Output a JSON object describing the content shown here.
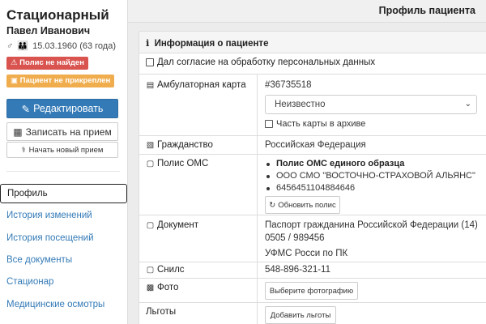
{
  "patient": {
    "last_name": "Стационарный",
    "first_names": "Павел Иванович",
    "dob": "15.03.1960 (63 года)",
    "badges": {
      "not_found": "Полис не найден",
      "not_attached": "Пациент не прикреплен"
    }
  },
  "actions": {
    "edit": "Редактировать",
    "appoint": "Записать на прием",
    "new_visit": "Начать новый прием"
  },
  "nav": {
    "items": [
      {
        "label": "Профиль",
        "active": true
      },
      {
        "label": "История изменений"
      },
      {
        "label": "История посещений"
      },
      {
        "label": "Все документы"
      },
      {
        "label": "Стационар"
      },
      {
        "label": "Медицинские осмотры"
      }
    ]
  },
  "header": {
    "title": "Профиль пациента"
  },
  "panel": {
    "title": "Информация о пациенте",
    "consent": "Дал согласие на обработку персональных данных",
    "outpatient_card": {
      "label": "Амбулаторная карта",
      "number": "#36735518",
      "select_value": "Неизвестно",
      "archive_label": "Часть карты в архиве"
    },
    "citizenship": {
      "label": "Гражданство",
      "value": "Российская Федерация"
    },
    "oms": {
      "label": "Полис ОМС",
      "items": [
        "Полис ОМС единого образца",
        "ООО СМО \"ВОСТОЧНО-СТРАХОВОЙ АЛЬЯНС\"",
        "6456451104884646"
      ],
      "refresh_label": "Обновить полис"
    },
    "document": {
      "label": "Документ",
      "line1": "Паспорт гражданина Российской Федерации (14)",
      "line2": "0505 / 989456",
      "line3": "УФМС Росси по ПК"
    },
    "snils": {
      "label": "Снилс",
      "value": "548-896-321-11"
    },
    "photo": {
      "label": "Фото",
      "button": "Выберите фотографию"
    },
    "benefits": {
      "label": "Льготы",
      "button": "Добавить льготы"
    }
  }
}
